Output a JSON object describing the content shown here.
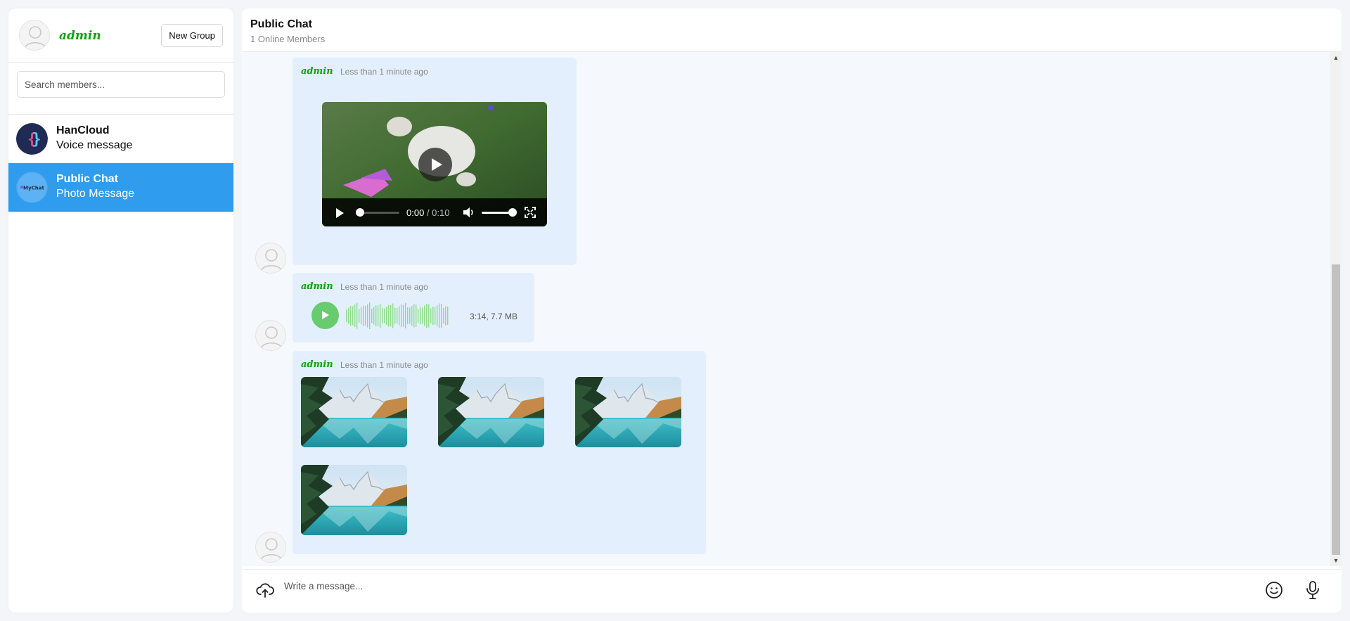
{
  "sidebar": {
    "user_name": "admin",
    "new_group_label": "New Group",
    "search_placeholder": "Search members...",
    "contacts": [
      {
        "name": "HanCloud",
        "subtitle": "Voice message",
        "avatar_text": "{ }"
      },
      {
        "name": "Public Chat",
        "subtitle": "Photo Message",
        "avatar_text": "MyChat"
      }
    ]
  },
  "chat": {
    "title": "Public Chat",
    "subtitle": "1 Online Members",
    "messages": [
      {
        "sender": "admin",
        "time": "Less than 1 minute ago",
        "type": "video",
        "current_time": "0:00",
        "duration": "/ 0:10"
      },
      {
        "sender": "admin",
        "time": "Less than 1 minute ago",
        "type": "voice",
        "meta": "3:14, 7.7 MB"
      },
      {
        "sender": "admin",
        "time": "Less than 1 minute ago",
        "type": "photos",
        "photo_count": 4
      }
    ],
    "input_placeholder": "Write a message..."
  },
  "colors": {
    "accent": "#2f9ced",
    "username_green": "#14a014",
    "bubble": "#e3effc",
    "voice_green": "#67cc6e"
  },
  "icons": [
    "user-avatar-icon",
    "upload-cloud-icon",
    "emoji-icon",
    "microphone-icon",
    "play-icon",
    "volume-icon",
    "fullscreen-icon"
  ]
}
